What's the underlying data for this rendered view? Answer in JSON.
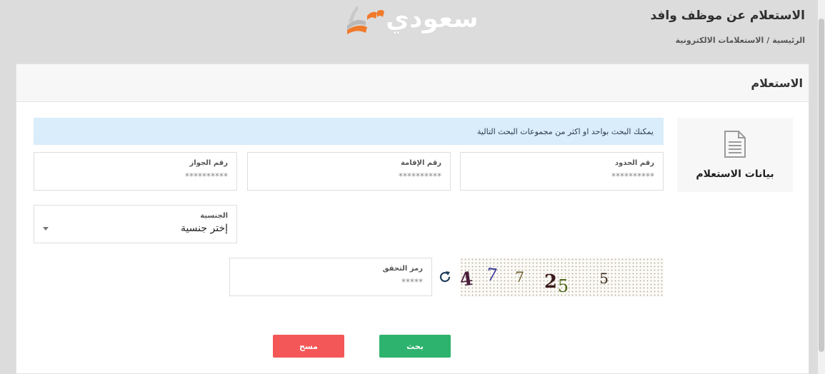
{
  "header": {
    "page_title": "الاستعلام عن موظف وافد",
    "breadcrumb": {
      "home": "الرئيسية",
      "separator": "/",
      "current": "الاستعلامات الالكترونية"
    },
    "logo": {
      "text": "سعودي",
      "mark_icon": "book-icon"
    }
  },
  "card": {
    "title": "الاستعلام",
    "side_tab": {
      "label": "بيانات الاستعلام",
      "icon": "document-icon"
    },
    "info_text": "يمكنك البحث بواحد او اكثر من مجموعات البحث التالية",
    "fields": {
      "border_number": {
        "label": "رقم الحدود",
        "placeholder": "**********"
      },
      "iqama_number": {
        "label": "رقم الإقامة",
        "placeholder": "**********"
      },
      "passport_number": {
        "label": "رقم الجواز",
        "placeholder": "**********"
      }
    },
    "nationality": {
      "label": "الجنسية",
      "value": "إختر جنسية"
    },
    "captcha": {
      "label": "رمز التحقق",
      "placeholder": "*****",
      "chars": [
        "4",
        "7",
        "7",
        "2",
        "5",
        "5"
      ]
    },
    "buttons": {
      "search": "بحث",
      "clear": "مسح"
    }
  },
  "colors": {
    "search_button": "#2db36e",
    "clear_button": "#f35757",
    "info_bg": "#d9edfb",
    "logo_orange": "#f07a2b"
  }
}
